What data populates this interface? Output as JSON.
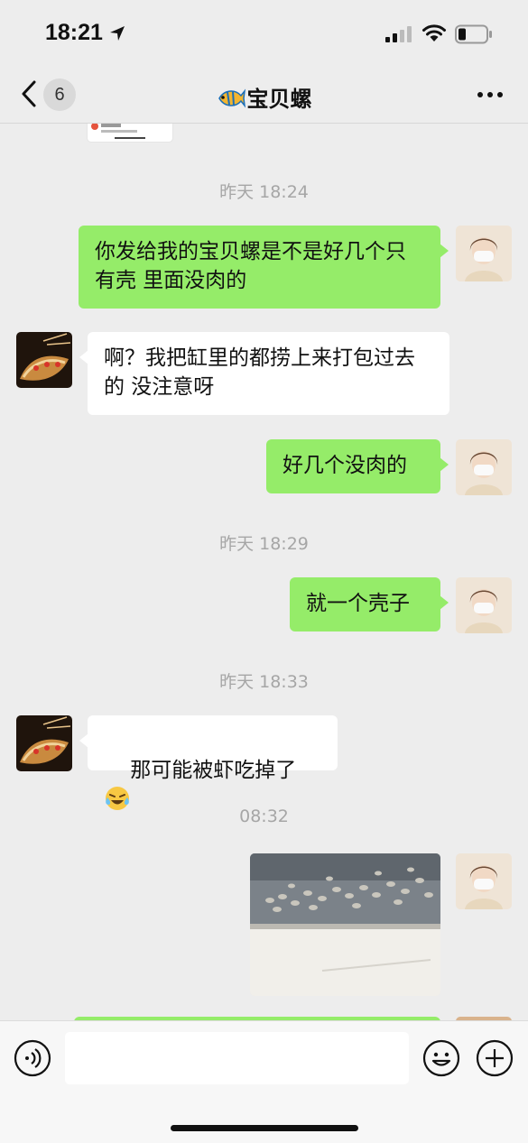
{
  "status_bar": {
    "time": "18:21"
  },
  "nav": {
    "unread_count": "6",
    "title": "宝贝螺"
  },
  "messages": [
    {
      "type": "timestamp",
      "text": "昨天 18:24"
    },
    {
      "type": "text",
      "direction": "out",
      "text": "你发给我的宝贝螺是不是好几个只有壳 里面没肉的"
    },
    {
      "type": "text",
      "direction": "in",
      "text": "啊？我把缸里的都捞上来打包过去的 没注意呀"
    },
    {
      "type": "text",
      "direction": "out",
      "text": "好几个没肉的"
    },
    {
      "type": "timestamp",
      "text": "昨天 18:29"
    },
    {
      "type": "text",
      "direction": "out",
      "text": "就一个壳子"
    },
    {
      "type": "timestamp",
      "text": "昨天 18:33"
    },
    {
      "type": "text",
      "direction": "in",
      "text": "那可能被虾吃掉了",
      "emoji": "face-with-tears-of-joy"
    },
    {
      "type": "timestamp",
      "text": "08:32"
    },
    {
      "type": "image",
      "direction": "out"
    }
  ],
  "input": {
    "value": "",
    "placeholder": ""
  },
  "colors": {
    "background": "#ededed",
    "outgoing_bubble": "#95ec69",
    "incoming_bubble": "#ffffff"
  }
}
